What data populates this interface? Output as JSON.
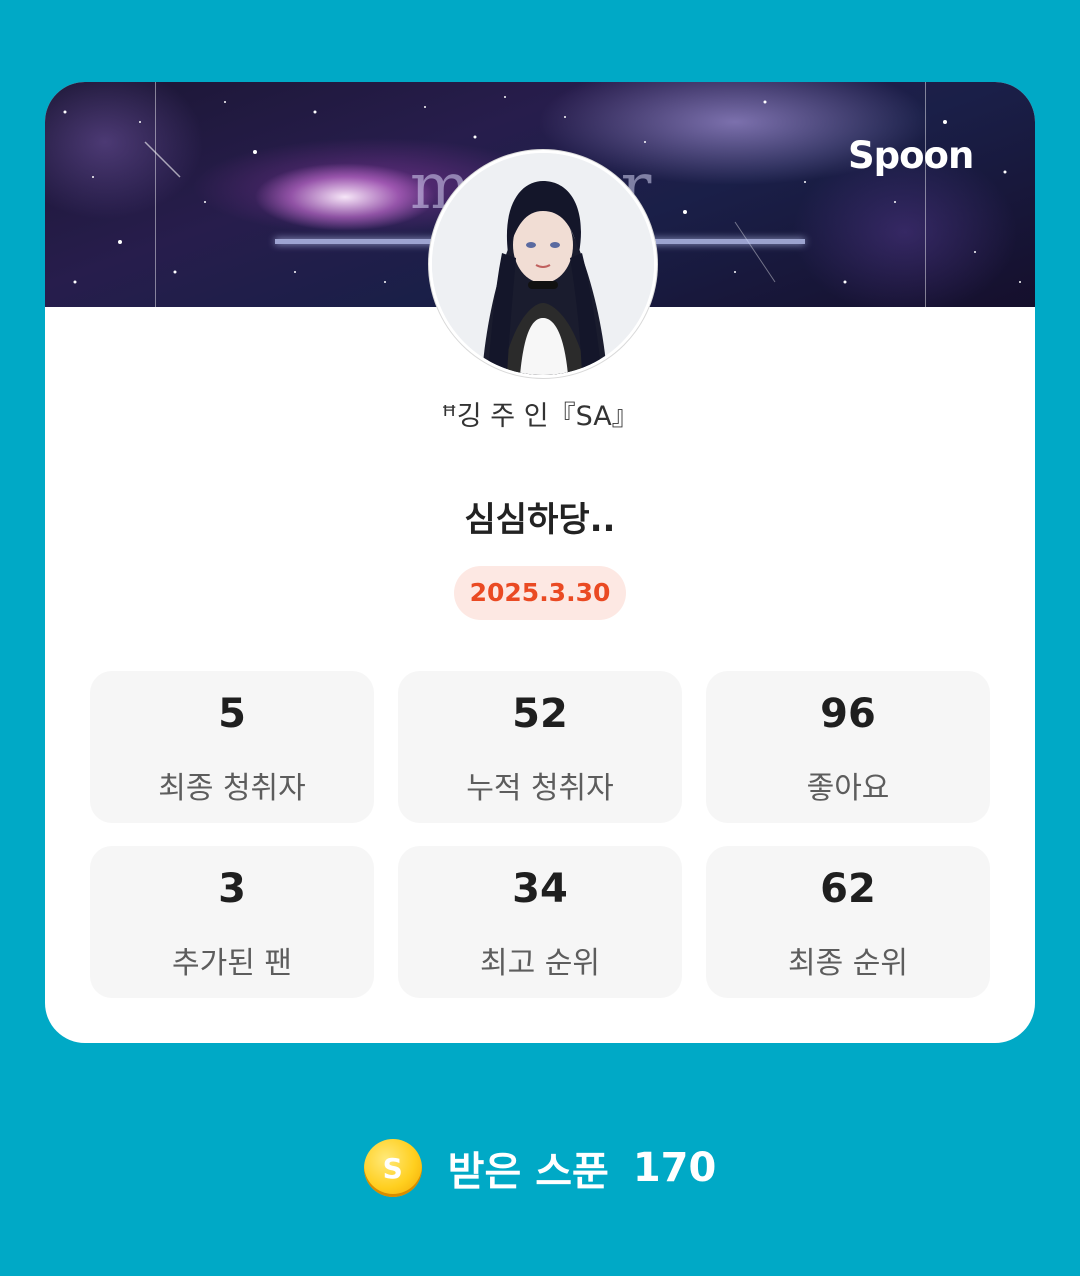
{
  "card": {
    "banner": {
      "overlay_text": "meteor",
      "logo": "Spoon"
    },
    "nickname": "ꟸ깅 주 인『SA』",
    "title": "심심하당..",
    "date": "2025.3.30"
  },
  "stats": [
    {
      "value": "5",
      "label": "최종 청취자"
    },
    {
      "value": "52",
      "label": "누적 청취자"
    },
    {
      "value": "96",
      "label": "좋아요"
    },
    {
      "value": "3",
      "label": "추가된 팬"
    },
    {
      "value": "34",
      "label": "최고 순위"
    },
    {
      "value": "62",
      "label": "최종 순위"
    }
  ],
  "footer": {
    "coin_icon": "spoon-coin-icon",
    "coin_letter": "S",
    "label": "받은 스푼",
    "value": "170"
  },
  "colors": {
    "background": "#00a9c6",
    "date_text": "#ea4a23",
    "date_bg": "#fde8e3",
    "coin": "#ffcf1f"
  }
}
